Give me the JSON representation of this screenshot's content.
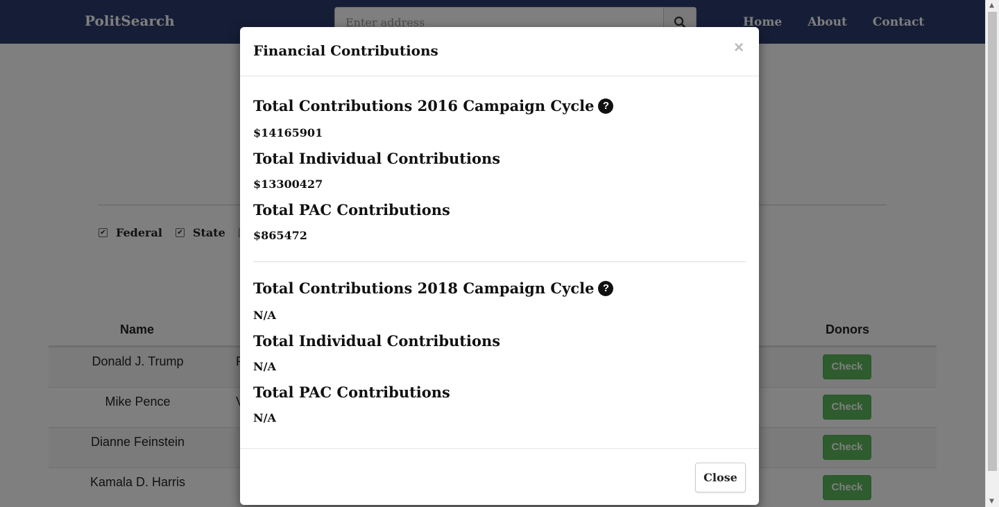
{
  "navbar": {
    "brand": "PolitSearch",
    "search_placeholder": "Enter address",
    "links": [
      "Home",
      "About",
      "Contact"
    ]
  },
  "filters": [
    {
      "label": "Federal",
      "checked": true
    },
    {
      "label": "State",
      "checked": true
    },
    {
      "label": "",
      "checked": true
    }
  ],
  "table": {
    "headers": {
      "name": "Name",
      "donors": "Donors"
    },
    "rows": [
      {
        "name": "Donald J. Trump",
        "position_partial": "P",
        "action": "Check"
      },
      {
        "name": "Mike Pence",
        "position_partial": "V",
        "action": "Check"
      },
      {
        "name": "Dianne Feinstein",
        "position_partial": "",
        "action": "Check"
      },
      {
        "name": "Kamala D. Harris",
        "position_partial": "",
        "action": "Check"
      }
    ]
  },
  "modal": {
    "title": "Financial Contributions",
    "close_symbol": "×",
    "cycle_2016": {
      "heading": "Total Contributions 2016 Campaign Cycle",
      "total": "$14165901",
      "individual_heading": "Total Individual Contributions",
      "individual": "$13300427",
      "pac_heading": "Total PAC Contributions",
      "pac": "$865472"
    },
    "cycle_2018": {
      "heading": "Total Contributions 2018 Campaign Cycle",
      "total": "N/A",
      "individual_heading": "Total Individual Contributions",
      "individual": "N/A",
      "pac_heading": "Total PAC Contributions",
      "pac": "N/A"
    },
    "help_icon": "?",
    "close_button": "Close"
  },
  "colors": {
    "navbar": "#2d3c6e",
    "check_button": "#5cb85c"
  }
}
